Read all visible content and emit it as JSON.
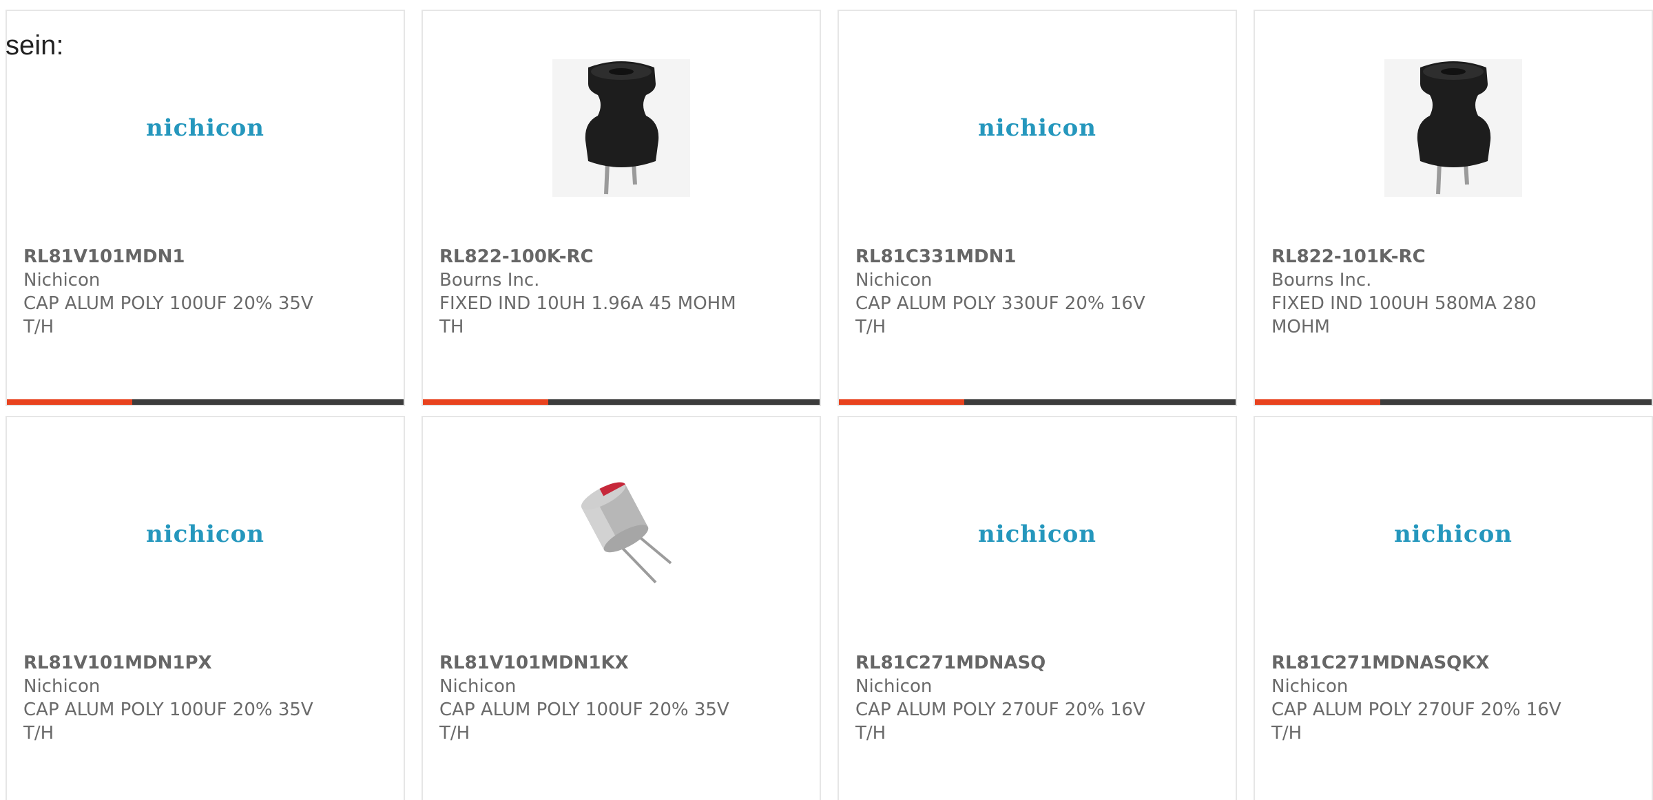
{
  "intro_text": "sein:",
  "cards": [
    {
      "part_number": "RL81V101MDN1",
      "manufacturer": "Nichicon",
      "desc_line1": "CAP ALUM POLY 100UF 20% 35V",
      "desc_line2": "T/H",
      "image_type": "nichicon-logo",
      "logo_text": "nichicon"
    },
    {
      "part_number": "RL822-100K-RC",
      "manufacturer": "Bourns Inc.",
      "desc_line1": "FIXED IND 10UH 1.96A 45 MOHM",
      "desc_line2": "TH",
      "image_type": "inductor-photo",
      "logo_text": ""
    },
    {
      "part_number": "RL81C331MDN1",
      "manufacturer": "Nichicon",
      "desc_line1": "CAP ALUM POLY 330UF 20% 16V",
      "desc_line2": "T/H",
      "image_type": "nichicon-logo",
      "logo_text": "nichicon"
    },
    {
      "part_number": "RL822-101K-RC",
      "manufacturer": "Bourns Inc.",
      "desc_line1": "FIXED IND 100UH 580MA 280",
      "desc_line2": "MOHM",
      "image_type": "inductor-photo",
      "logo_text": ""
    },
    {
      "part_number": "RL81V101MDN1PX",
      "manufacturer": "Nichicon",
      "desc_line1": "CAP ALUM POLY 100UF 20% 35V",
      "desc_line2": "T/H",
      "image_type": "nichicon-logo",
      "logo_text": "nichicon"
    },
    {
      "part_number": "RL81V101MDN1KX",
      "manufacturer": "Nichicon",
      "desc_line1": "CAP ALUM POLY 100UF 20% 35V",
      "desc_line2": "T/H",
      "image_type": "capacitor-photo",
      "logo_text": ""
    },
    {
      "part_number": "RL81C271MDNASQ",
      "manufacturer": "Nichicon",
      "desc_line1": "CAP ALUM POLY 270UF 20% 16V",
      "desc_line2": "T/H",
      "image_type": "nichicon-logo",
      "logo_text": "nichicon"
    },
    {
      "part_number": "RL81C271MDNASQKX",
      "manufacturer": "Nichicon",
      "desc_line1": "CAP ALUM POLY 270UF 20% 16V",
      "desc_line2": "T/H",
      "image_type": "nichicon-logo",
      "logo_text": "nichicon"
    }
  ],
  "colors": {
    "brand_logo": "#2597bd",
    "accent_bar": "#e8421e",
    "bar_base": "#3c3c3c",
    "card_border": "#e6e6e6"
  }
}
